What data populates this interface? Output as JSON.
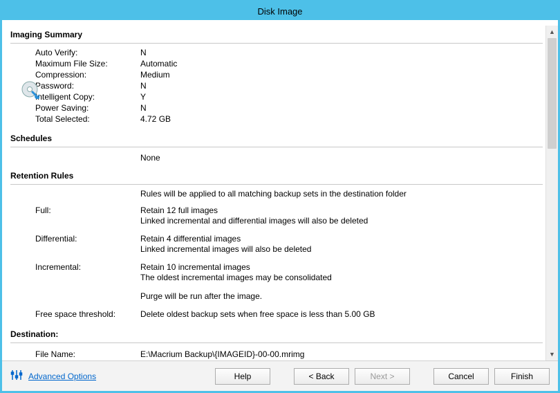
{
  "window": {
    "title": "Disk Image"
  },
  "summary": {
    "header": "Imaging Summary",
    "items": [
      {
        "label": "Auto Verify:",
        "value": "N"
      },
      {
        "label": "Maximum File Size:",
        "value": "Automatic"
      },
      {
        "label": "Compression:",
        "value": "Medium"
      },
      {
        "label": "Password:",
        "value": "N"
      },
      {
        "label": "Intelligent Copy:",
        "value": "Y"
      },
      {
        "label": "Power Saving:",
        "value": "N"
      },
      {
        "label": "Total Selected:",
        "value": "4.72 GB"
      }
    ]
  },
  "schedules": {
    "header": "Schedules",
    "value": "None"
  },
  "retention": {
    "header": "Retention Rules",
    "note": "Rules will be applied to all matching backup sets in the destination folder",
    "full": {
      "label": "Full:",
      "line1": "Retain 12 full images",
      "line2": "Linked incremental and differential images will also be deleted"
    },
    "differential": {
      "label": "Differential:",
      "line1": "Retain 4 differential images",
      "line2": "Linked incremental images will also be deleted"
    },
    "incremental": {
      "label": "Incremental:",
      "line1": "Retain 10 incremental images",
      "line2": "The oldest incremental images may be consolidated"
    },
    "purge": "Purge will be run after the image.",
    "threshold": {
      "label": "Free space threshold:",
      "value": "Delete oldest backup sets when free space is less than 5.00 GB"
    }
  },
  "destination": {
    "header": "Destination:",
    "filename_label": "File Name:",
    "filename_value": "E:\\Macrium Backup\\{IMAGEID}-00-00.mrimg"
  },
  "footer": {
    "advanced": "Advanced Options",
    "help": "Help",
    "back": "< Back",
    "next": "Next >",
    "cancel": "Cancel",
    "finish": "Finish"
  }
}
